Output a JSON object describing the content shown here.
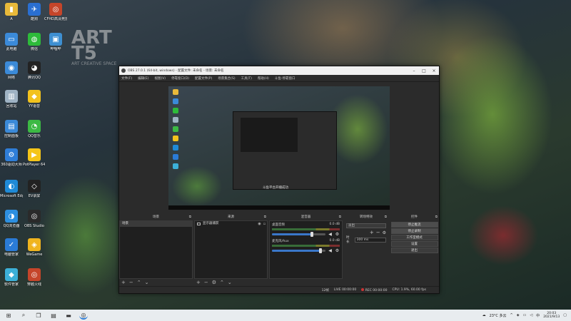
{
  "wallpaper": {
    "art_text": "ART",
    "art_number": "T5",
    "art_sub": "ART CREATIVE SPACE"
  },
  "desktop_icons": [
    {
      "label": "A",
      "icon": "folder-icon",
      "color": "#e8b93a",
      "glyph": "▮"
    },
    {
      "label": "酷狗",
      "icon": "bird-icon",
      "color": "#2a6fd1",
      "glyph": "✈"
    },
    {
      "label": "CFHD高清竞技大区",
      "icon": "game-icon",
      "color": "#c5452a",
      "glyph": "◎"
    },
    {
      "label": "此电脑",
      "icon": "computer-icon",
      "color": "#3b8ad8",
      "glyph": "▭"
    },
    {
      "label": "微信",
      "icon": "wechat-icon",
      "color": "#2dbb3a",
      "glyph": "◍"
    },
    {
      "label": "哔哩哔",
      "icon": "bilibili-icon",
      "color": "#3e8fd1",
      "glyph": "▣"
    },
    {
      "label": "网络",
      "icon": "network-icon",
      "color": "#3b8ad8",
      "glyph": "◉"
    },
    {
      "label": "腾讯QQ",
      "icon": "qq-icon",
      "color": "#222222",
      "glyph": "◕"
    },
    {
      "label": "回收站",
      "icon": "recycle-bin-icon",
      "color": "#9fb3c4",
      "glyph": "▥"
    },
    {
      "label": "YY语音",
      "icon": "yy-icon",
      "color": "#f2c21d",
      "glyph": "◆"
    },
    {
      "label": "控制面板",
      "icon": "control-panel-icon",
      "color": "#3b8ad8",
      "glyph": "▤"
    },
    {
      "label": "QQ音乐",
      "icon": "qqmusic-icon",
      "color": "#3cb944",
      "glyph": "◔"
    },
    {
      "label": "360驱动大师",
      "icon": "driver-icon",
      "color": "#2f7ed8",
      "glyph": "⚙"
    },
    {
      "label": "PotPlayer 64 bit",
      "icon": "potplayer-icon",
      "color": "#f5c518",
      "glyph": "▶"
    },
    {
      "label": "Microsoft Edge",
      "icon": "edge-icon",
      "color": "#1f8ad6",
      "glyph": "◐"
    },
    {
      "label": "EV录屏",
      "icon": "evcapture-icon",
      "color": "#222222",
      "glyph": "◇"
    },
    {
      "label": "QQ浏览器",
      "icon": "qqbrowser-icon",
      "color": "#2d8fe0",
      "glyph": "◑"
    },
    {
      "label": "OBS Studio",
      "icon": "obs-icon",
      "color": "#2a2a2a",
      "glyph": "◎"
    },
    {
      "label": "电脑管家",
      "icon": "pc-manager-icon",
      "color": "#2a7bd6",
      "glyph": "✓"
    },
    {
      "label": "WeGame",
      "icon": "wegame-icon",
      "color": "#f0b41e",
      "glyph": "◈"
    },
    {
      "label": "软件管家",
      "icon": "software-manager-icon",
      "color": "#3cb0d8",
      "glyph": "◆"
    },
    {
      "label": "穿越火线",
      "icon": "crossfire-icon",
      "color": "#c5452a",
      "glyph": "◎"
    }
  ],
  "obs": {
    "title": "OBS 27.0.1 (64-bit, windows) - 配置文件: 未命名 - 场景: 未命名",
    "menu": [
      "文件(F)",
      "编辑(E)",
      "视图(V)",
      "停靠窗口(D)",
      "配置文件(P)",
      "场景集合(S)",
      "工具(T)",
      "帮助(H)",
      "斗鱼-停靠窗口"
    ],
    "preview_caption": "斗鱼平台开播成功",
    "docks": {
      "scenes": {
        "title": "场景",
        "items": [
          "场景"
        ]
      },
      "sources": {
        "title": "来源",
        "items": [
          "显示器捕获"
        ]
      },
      "mixer": {
        "title": "混音器",
        "channels": [
          {
            "name": "桌面音频",
            "db": "0.0 dB",
            "level": 0.75,
            "fill_color": "#3a77c9"
          },
          {
            "name": "麦克风/Aux",
            "db": "0.0 dB",
            "level": 0.9,
            "fill_color": "#3a77c9"
          }
        ]
      },
      "transitions": {
        "title": "转场特效",
        "type": "淡出",
        "duration_label": "时长",
        "duration": "300 ms"
      },
      "controls": {
        "title": "控件",
        "buttons": [
          "停止推流",
          "停止录制",
          "工作室模式",
          "设置",
          "退出"
        ]
      }
    },
    "status": {
      "live_label": "LIVE",
      "live_time": "00:00:00",
      "rec_label": "REC",
      "rec_time": "00:00:00",
      "cpu": "CPU: 1.9%, 60.00 fps",
      "dropped": "12帧"
    }
  },
  "taskbar": {
    "weather": "23°C 多云",
    "time": "20:03",
    "date": "2021/9/13",
    "ime": "中"
  }
}
